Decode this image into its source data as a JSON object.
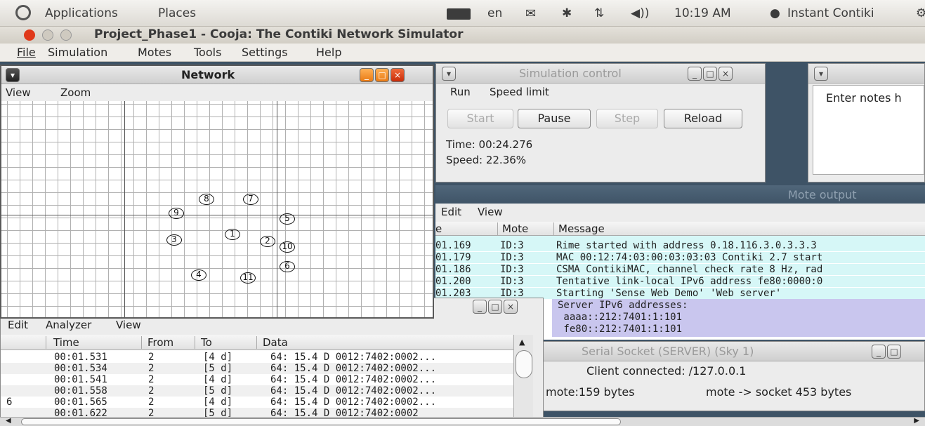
{
  "top_panel": {
    "applications": "Applications",
    "places": "Places",
    "keyboard": "en",
    "time": "10:19 AM",
    "user": "Instant Contiki"
  },
  "window": {
    "title": "Project_Phase1 - Cooja: The Contiki Network Simulator"
  },
  "menubar": [
    "File",
    "Simulation",
    "Motes",
    "Tools",
    "Settings",
    "Help"
  ],
  "network": {
    "title": "Network",
    "menu": [
      "View",
      "Zoom"
    ],
    "motes": [
      "1",
      "2",
      "3",
      "4",
      "5",
      "6",
      "7",
      "8",
      "9",
      "10",
      "11"
    ]
  },
  "sim_control": {
    "title": "Simulation control",
    "menu": [
      "Run",
      "Speed limit"
    ],
    "buttons": {
      "start": "Start",
      "pause": "Pause",
      "step": "Step",
      "reload": "Reload"
    },
    "time": "Time: 00:24.276",
    "speed": "Speed: 22.36%"
  },
  "notes": {
    "placeholder": "Enter notes h"
  },
  "mote_output": {
    "title": "Mote output",
    "menu": [
      "Edit",
      "View"
    ],
    "headers": [
      "e",
      "Mote",
      "Message"
    ],
    "rows": [
      {
        "time": "01.169",
        "mote": "ID:3",
        "msg": "Rime started with address 0.18.116.3.0.3.3.3"
      },
      {
        "time": "01.179",
        "mote": "ID:3",
        "msg": "MAC 00:12:74:03:00:03:03:03 Contiki 2.7 start"
      },
      {
        "time": "01.186",
        "mote": "ID:3",
        "msg": "CSMA ContikiMAC, channel check rate 8 Hz, rad"
      },
      {
        "time": "01.200",
        "mote": "ID:3",
        "msg": "Tentative link-local IPv6 address fe80:0000:0"
      },
      {
        "time": "01.203",
        "mote": "ID:3",
        "msg": "Starting 'Sense Web Demo' 'Web server'"
      }
    ],
    "highlight": [
      "Server IPv6 addresses:",
      " aaaa::212:7401:1:101",
      " fe80::212:7401:1:101"
    ]
  },
  "radio": {
    "menu": [
      "Edit",
      "Analyzer",
      "View"
    ],
    "headers": [
      "Time",
      "From",
      "To",
      "Data"
    ],
    "rows": [
      {
        "pre": "",
        "time": "00:01.531",
        "from": "2",
        "to": "[4 d]",
        "data": "64: 15.4 D 0012:7402:0002..."
      },
      {
        "pre": "",
        "time": "00:01.534",
        "from": "2",
        "to": "[5 d]",
        "data": "64: 15.4 D 0012:7402:0002..."
      },
      {
        "pre": "",
        "time": "00:01.541",
        "from": "2",
        "to": "[4 d]",
        "data": "64: 15.4 D 0012:7402:0002..."
      },
      {
        "pre": "",
        "time": "00:01.558",
        "from": "2",
        "to": "[5 d]",
        "data": "64: 15.4 D 0012:7402:0002..."
      },
      {
        "pre": "6",
        "time": "00:01.565",
        "from": "2",
        "to": "[4 d]",
        "data": "64: 15.4 D 0012:7402:0002..."
      },
      {
        "pre": "",
        "time": "00:01.622",
        "from": "2",
        "to": "[5 d]",
        "data": "64: 15.4 D 0012:7402:0002"
      }
    ]
  },
  "serial_socket": {
    "title": "Serial Socket (SERVER) (Sky 1)",
    "status": "Client connected: /127.0.0.1",
    "in_bytes": "mote:159 bytes",
    "out_bytes": "mote -> socket 453 bytes"
  },
  "colors": {
    "desktop": "#3e5366",
    "mote_output_row": "#d6f7f7",
    "highlight_row": "#c9c6ee",
    "close_red": "#e0391a",
    "orange_btn": "#f0802c"
  }
}
